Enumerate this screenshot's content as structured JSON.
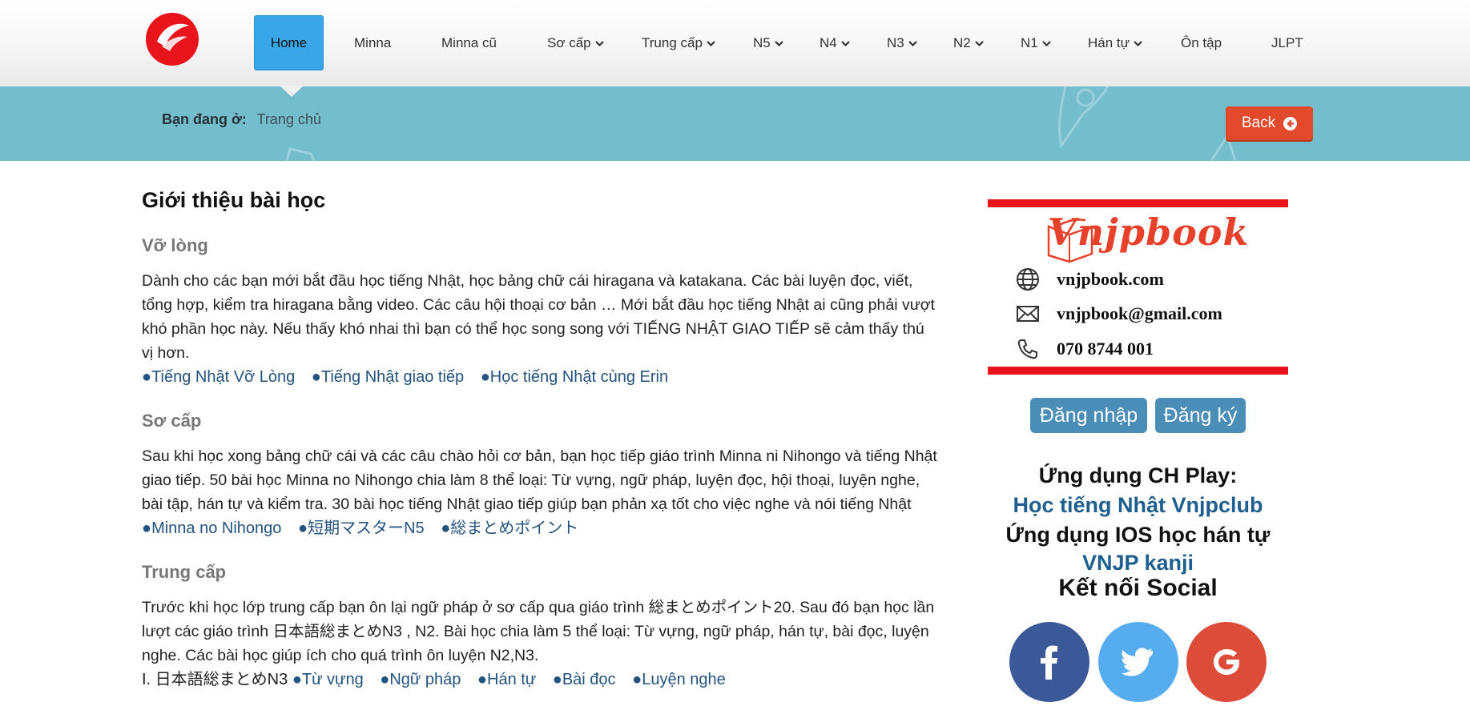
{
  "nav": {
    "logo_alt": "Vnjp logo",
    "items": [
      {
        "label": "Home",
        "active": true
      },
      {
        "label": "Minna",
        "dropdown": false
      },
      {
        "label": "Minna cũ",
        "dropdown": false
      },
      {
        "label": "Sơ cấp",
        "dropdown": true
      },
      {
        "label": "Trung cấp",
        "dropdown": true
      },
      {
        "label": "N5",
        "dropdown": true
      },
      {
        "label": "N4",
        "dropdown": true
      },
      {
        "label": "N3",
        "dropdown": true
      },
      {
        "label": "N2",
        "dropdown": true
      },
      {
        "label": "N1",
        "dropdown": true
      },
      {
        "label": "Hán tự",
        "dropdown": true
      },
      {
        "label": "Ôn tập",
        "dropdown": false
      },
      {
        "label": "JLPT",
        "dropdown": false
      }
    ]
  },
  "breadcrumb": {
    "prefix": "Bạn đang ở:",
    "current": "Trang chủ",
    "back_label": "Back"
  },
  "main": {
    "title": "Giới thiệu bài học",
    "sections": [
      {
        "heading": "Vỡ lòng",
        "text": "Dành cho các bạn mới bắt đầu học tiếng Nhật, học bảng chữ cái hiragana và katakana. Các bài luyện đọc, viết, tổng hợp, kiểm tra hiragana bằng video. Các câu hội thoại cơ bản … Mới bắt đầu học tiếng Nhật ai cũng phải vượt khó phần học này. Nếu thấy khó nhai thì bạn có thể học song song với TIẾNG NHẬT GIAO TIẾP sẽ cảm thấy thú vị hơn.",
        "links": [
          "●Tiếng Nhật Vỡ Lòng",
          "●Tiếng Nhật giao tiếp",
          "●Học tiếng Nhật cùng Erin"
        ]
      },
      {
        "heading": "Sơ cấp",
        "text": "Sau khi học xong bảng chữ cái và các câu chào hỏi cơ bản, bạn học tiếp giáo trình Minna ni Nihongo và tiếng Nhật giao tiếp. 50 bài học Minna no Nihongo chia làm 8 thể loại: Từ vựng, ngữ pháp, luyện đọc, hội thoại, luyện nghe, bài tập, hán tự và kiểm tra. 30 bài học tiếng Nhật giao tiếp giúp bạn phản xạ tốt cho việc nghe và nói tiếng Nhật",
        "links": [
          "●Minna no Nihongo",
          "●短期マスターN5",
          "●総まとめポイント"
        ]
      },
      {
        "heading": "Trung cấp",
        "text": "Trước khi học lớp trung cấp bạn ôn lại ngữ pháp ở sơ cấp qua giáo trình 総まとめポイント20. Sau đó bạn học lần lượt các giáo trình 日本語総まとめN3 , N2. Bài học chia làm 5 thể loại: Từ vựng, ngữ pháp, hán tự, bài đọc, luyện nghe. Các bài học giúp ích cho quá trình ôn luyện N2,N3.",
        "line_prefix": "I. 日本語総まとめN3",
        "links": [
          "●Từ vựng",
          "●Ngữ pháp",
          "●Hán tự",
          "●Bài đọc",
          "●Luyện nghe"
        ]
      }
    ]
  },
  "sidebar": {
    "card": {
      "brand": "Vnjpbook",
      "website": "vnjpbook.com",
      "email": "vnjpbook@gmail.com",
      "phone": "070 8744 001"
    },
    "login_label": "Đăng nhập",
    "register_label": "Đăng ký",
    "app_ch_heading": "Ứng dụng CH Play:",
    "app_ch_link": "Học tiếng Nhật Vnjpclub",
    "app_ios_heading": "Ứng dụng IOS học hán tự",
    "app_ios_link": "VNJP kanji",
    "social_heading": "Kết nối Social",
    "social": [
      {
        "name": "facebook",
        "color": "#3b5998"
      },
      {
        "name": "twitter",
        "color": "#55acee"
      },
      {
        "name": "google",
        "color": "#dd4b39"
      }
    ]
  },
  "colors": {
    "accent_blue": "#3aa6ea",
    "band": "#74bdcc",
    "back_button": "#e24a2b",
    "link": "#23537f"
  }
}
